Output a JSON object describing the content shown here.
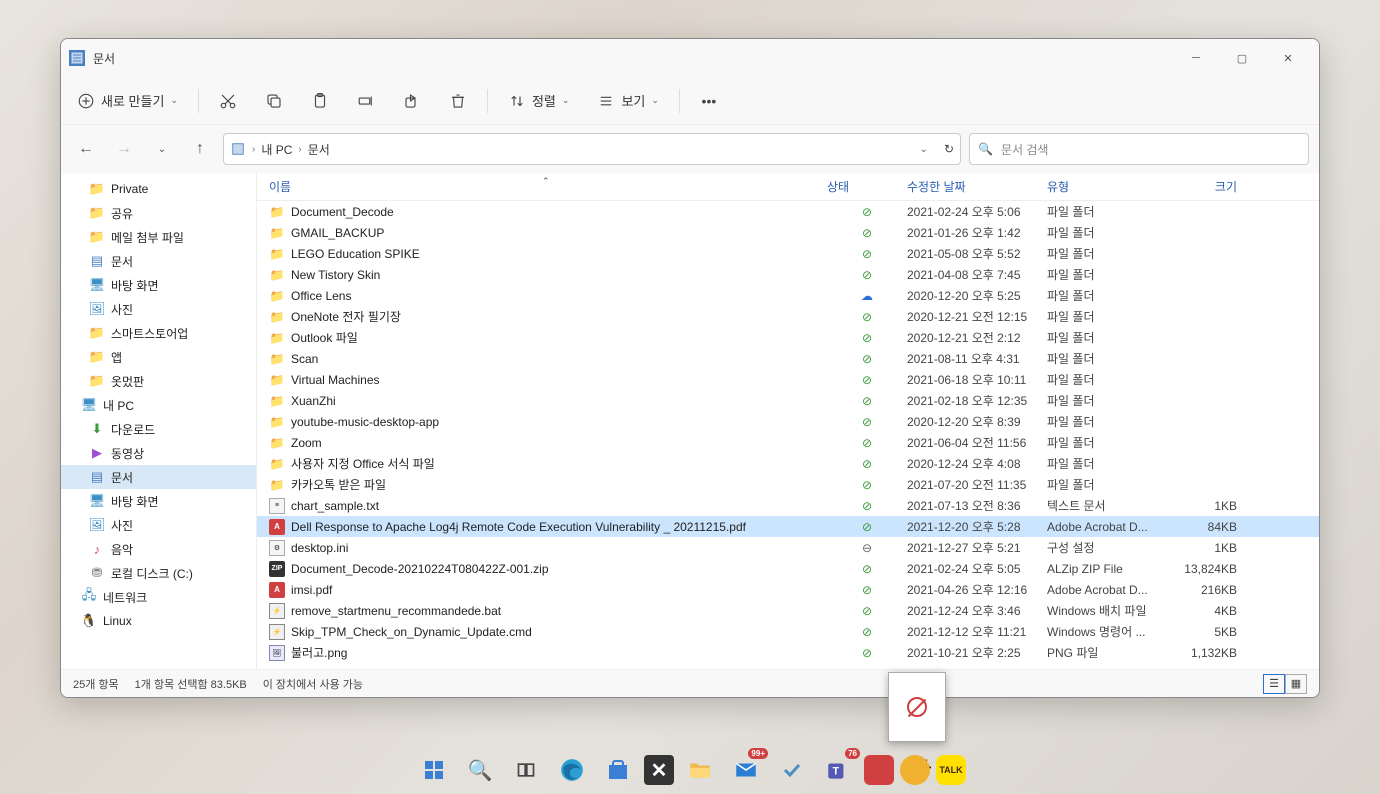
{
  "window": {
    "title": "문서"
  },
  "toolbar": {
    "new": "새로 만들기",
    "sort": "정렬",
    "view": "보기"
  },
  "breadcrumb": {
    "pc": "내 PC",
    "folder": "문서"
  },
  "search": {
    "placeholder": "문서 검색"
  },
  "sidebar": {
    "items": [
      {
        "label": "Private",
        "icon": "folder",
        "lv": 2
      },
      {
        "label": "공유",
        "icon": "folder",
        "lv": 2
      },
      {
        "label": "메일 첨부 파일",
        "icon": "folder",
        "lv": 2
      },
      {
        "label": "문서",
        "icon": "doc",
        "lv": 2
      },
      {
        "label": "바탕 화면",
        "icon": "desktop",
        "lv": 2
      },
      {
        "label": "사진",
        "icon": "photo",
        "lv": 2
      },
      {
        "label": "스마트스토어업",
        "icon": "folder",
        "lv": 2
      },
      {
        "label": "앱",
        "icon": "folder",
        "lv": 2
      },
      {
        "label": "옷멌판",
        "icon": "folder",
        "lv": 2
      },
      {
        "label": "내 PC",
        "icon": "pc",
        "lv": 1
      },
      {
        "label": "다운로드",
        "icon": "download",
        "lv": 2
      },
      {
        "label": "동영상",
        "icon": "video",
        "lv": 2
      },
      {
        "label": "문서",
        "icon": "doc",
        "lv": 2,
        "selected": true
      },
      {
        "label": "바탕 화면",
        "icon": "desktop",
        "lv": 2
      },
      {
        "label": "사진",
        "icon": "photo",
        "lv": 2
      },
      {
        "label": "음악",
        "icon": "music",
        "lv": 2
      },
      {
        "label": "로컬 디스크 (C:)",
        "icon": "disk",
        "lv": 2
      },
      {
        "label": "네트워크",
        "icon": "network",
        "lv": 1
      },
      {
        "label": "Linux",
        "icon": "linux",
        "lv": 1
      }
    ]
  },
  "columns": {
    "name": "이름",
    "status": "상태",
    "date": "수정한 날짜",
    "type": "유형",
    "size": "크기"
  },
  "files": [
    {
      "icon": "folder",
      "name": "Document_Decode",
      "status": "sync",
      "date": "2021-02-24 오후 5:06",
      "type": "파일 폴더",
      "size": ""
    },
    {
      "icon": "folder",
      "name": "GMAIL_BACKUP",
      "status": "sync",
      "date": "2021-01-26 오후 1:42",
      "type": "파일 폴더",
      "size": ""
    },
    {
      "icon": "folder",
      "name": "LEGO Education SPIKE",
      "status": "sync",
      "date": "2021-05-08 오후 5:52",
      "type": "파일 폴더",
      "size": ""
    },
    {
      "icon": "folder",
      "name": "New Tistory Skin",
      "status": "sync",
      "date": "2021-04-08 오후 7:45",
      "type": "파일 폴더",
      "size": ""
    },
    {
      "icon": "folder",
      "name": "Office Lens",
      "status": "cloud",
      "date": "2020-12-20 오후 5:25",
      "type": "파일 폴더",
      "size": ""
    },
    {
      "icon": "folder",
      "name": "OneNote 전자 필기장",
      "status": "sync",
      "date": "2020-12-21 오전 12:15",
      "type": "파일 폴더",
      "size": ""
    },
    {
      "icon": "folder",
      "name": "Outlook 파일",
      "status": "sync",
      "date": "2020-12-21 오전 2:12",
      "type": "파일 폴더",
      "size": ""
    },
    {
      "icon": "folder",
      "name": "Scan",
      "status": "sync",
      "date": "2021-08-11 오후 4:31",
      "type": "파일 폴더",
      "size": ""
    },
    {
      "icon": "folder",
      "name": "Virtual Machines",
      "status": "sync",
      "date": "2021-06-18 오후 10:11",
      "type": "파일 폴더",
      "size": ""
    },
    {
      "icon": "folder",
      "name": "XuanZhi",
      "status": "sync",
      "date": "2021-02-18 오후 12:35",
      "type": "파일 폴더",
      "size": ""
    },
    {
      "icon": "folder",
      "name": "youtube-music-desktop-app",
      "status": "sync",
      "date": "2020-12-20 오후 8:39",
      "type": "파일 폴더",
      "size": ""
    },
    {
      "icon": "folder",
      "name": "Zoom",
      "status": "sync",
      "date": "2021-06-04 오전 11:56",
      "type": "파일 폴더",
      "size": ""
    },
    {
      "icon": "folder",
      "name": "사용자 지정 Office 서식 파일",
      "status": "sync",
      "date": "2020-12-24 오후 4:08",
      "type": "파일 폴더",
      "size": ""
    },
    {
      "icon": "folder",
      "name": "카카오톡 받은 파일",
      "status": "sync",
      "date": "2021-07-20 오전 11:35",
      "type": "파일 폴더",
      "size": ""
    },
    {
      "icon": "txt",
      "name": "chart_sample.txt",
      "status": "sync",
      "date": "2021-07-13 오전 8:36",
      "type": "텍스트 문서",
      "size": "1KB"
    },
    {
      "icon": "pdf",
      "name": "Dell Response to Apache Log4j Remote Code Execution Vulnerability _ 20211215.pdf",
      "status": "sync",
      "date": "2021-12-20 오후 5:28",
      "type": "Adobe Acrobat D...",
      "size": "84KB",
      "selected": true
    },
    {
      "icon": "ini",
      "name": "desktop.ini",
      "status": "dash",
      "date": "2021-12-27 오후 5:21",
      "type": "구성 설정",
      "size": "1KB"
    },
    {
      "icon": "zip",
      "name": "Document_Decode-20210224T080422Z-001.zip",
      "status": "sync",
      "date": "2021-02-24 오후 5:05",
      "type": "ALZip ZIP File",
      "size": "13,824KB"
    },
    {
      "icon": "pdf",
      "name": "imsi.pdf",
      "status": "sync",
      "date": "2021-04-26 오후 12:16",
      "type": "Adobe Acrobat D...",
      "size": "216KB"
    },
    {
      "icon": "bat",
      "name": "remove_startmenu_recommandede.bat",
      "status": "sync",
      "date": "2021-12-24 오후 3:46",
      "type": "Windows 배치 파일",
      "size": "4KB"
    },
    {
      "icon": "bat",
      "name": "Skip_TPM_Check_on_Dynamic_Update.cmd",
      "status": "sync",
      "date": "2021-12-12 오후 11:21",
      "type": "Windows 명령어 ...",
      "size": "5KB"
    },
    {
      "icon": "png",
      "name": "불러고.png",
      "status": "sync",
      "date": "2021-10-21 오후 2:25",
      "type": "PNG 파일",
      "size": "1,132KB"
    }
  ],
  "statusbar": {
    "count": "25개 항목",
    "selection": "1개 항목 선택함 83.5KB",
    "availability": "이 장치에서 사용 가능"
  },
  "taskbar": {
    "badges": {
      "mail": "99+",
      "teams": "76"
    }
  }
}
